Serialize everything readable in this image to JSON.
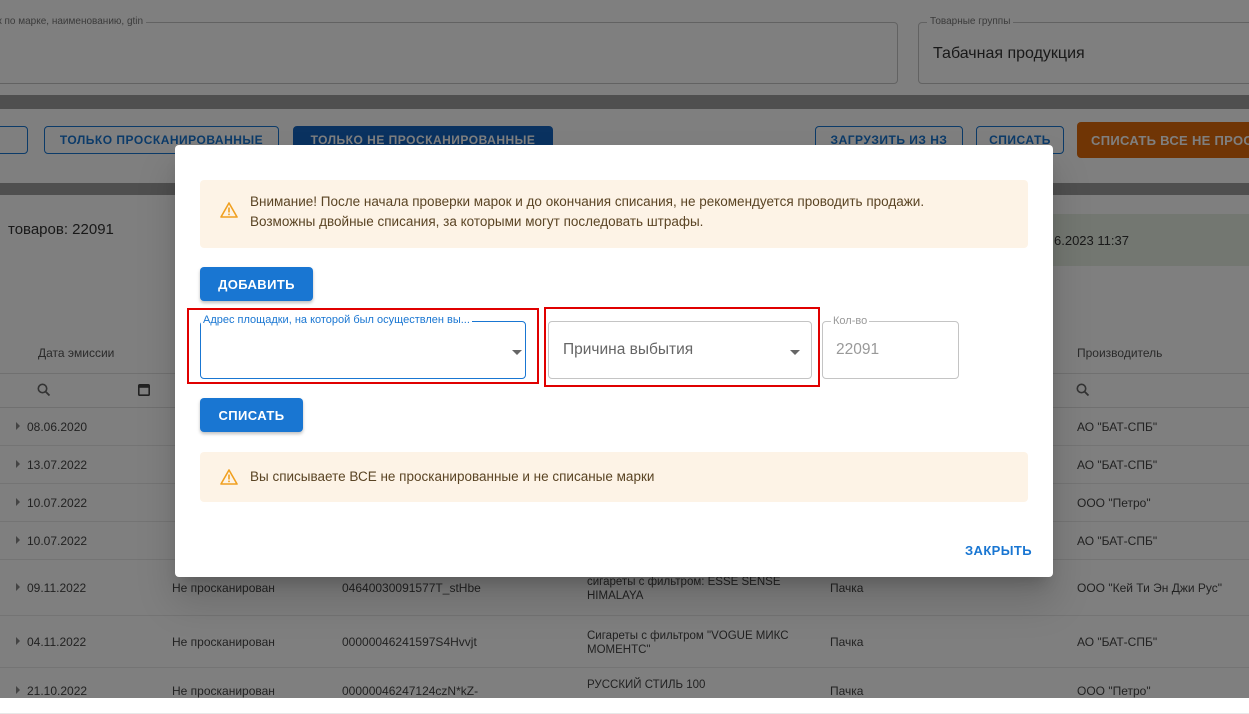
{
  "filters": {
    "search_label": "Поиск по марке, наименованию, gtin",
    "group_label": "Товарные группы",
    "group_value": "Табачная продукция"
  },
  "toolbar": {
    "only_scanned": "Только просканированные",
    "only_not_scanned": "Только не просканированные",
    "load_from": "Загрузить из НЗ",
    "write_off": "Списать",
    "write_off_all": "Списать все не просканированные"
  },
  "info": {
    "goods_count": "товаров: 22091",
    "date_text": "6.2023 11:37"
  },
  "grid": {
    "columns": {
      "emission_date": "Дата эмиссии",
      "manufacturer": "Производитель"
    },
    "rows": [
      {
        "date": "08.06.2020",
        "status": "",
        "code": "",
        "name": "",
        "unit": "",
        "maker": "АО \"БАТ-СПБ\""
      },
      {
        "date": "13.07.2022",
        "status": "",
        "code": "",
        "name": "",
        "unit": "",
        "maker": "АО \"БАТ-СПБ\""
      },
      {
        "date": "10.07.2022",
        "status": "",
        "code": "",
        "name": "",
        "unit": "",
        "maker": "ООО \"Петро\""
      },
      {
        "date": "10.07.2022",
        "status": "",
        "code": "",
        "name": "",
        "unit": "",
        "maker": "АО \"БАТ-СПБ\""
      },
      {
        "date": "09.11.2022",
        "status": "Не просканирован",
        "code": "04640030091577T_stHbe",
        "name": "сигареты с фильтром: ESSE SENSE HIMALAYA",
        "unit": "Пачка",
        "maker": "ООО \"Кей Ти Эн Джи Рус\""
      },
      {
        "date": "04.11.2022",
        "status": "Не просканирован",
        "code": "00000046241597S4Hvvjt",
        "name": "Сигареты с фильтром \"VOGUE МИКС МОМЕНТС\"",
        "unit": "Пачка",
        "maker": "АО \"БАТ-СПБ\""
      },
      {
        "date": "21.10.2022",
        "status": "Не просканирован",
        "code": "00000046247124czN*kZ-",
        "name": "РУССКИЙ СТИЛЬ 100",
        "unit": "Пачка",
        "maker": "ООО \"Петро\""
      }
    ]
  },
  "modal": {
    "warning_line1": "Внимание! После начала проверки марок и до окончания списания, не рекомендуется проводить продажи.",
    "warning_line2": "Возможны двойные списания, за которыми могут последовать штрафы.",
    "add_button": "ДОБАВИТЬ",
    "address_label": "Адрес площадки, на которой был осуществлен вы...",
    "address_value": "",
    "reason_placeholder": "Причина выбытия",
    "qty_label": "Кол-во",
    "qty_value": "22091",
    "write_off_button": "СПИСАТЬ",
    "notice": "Вы списываете ВСЕ не просканированные и не списаные марки",
    "close_button": "ЗАКРЫТЬ"
  },
  "colors": {
    "primary": "#1976d2",
    "accent_orange": "#e06b0b",
    "warning_bg": "#fdf3e6",
    "warning_icon": "#f0a020",
    "highlight_red": "#e00000"
  }
}
